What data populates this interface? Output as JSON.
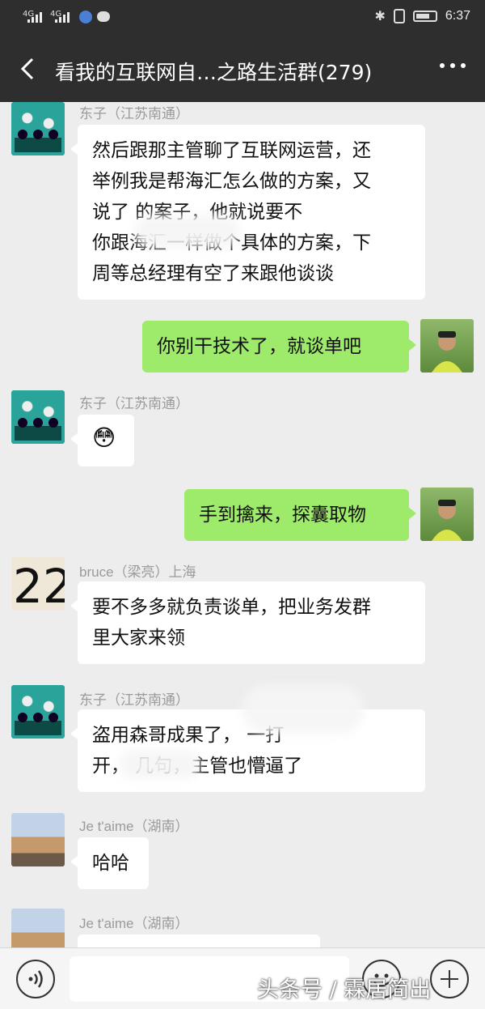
{
  "status_bar": {
    "signal1": "4G",
    "signal2": "4G",
    "notif_badge": "✉",
    "time": "6:37"
  },
  "header": {
    "title": "看我的互联网自…之路生活群(279)",
    "back_icon": "chevron-left-icon",
    "more_icon": "more-dots-icon"
  },
  "messages": [
    {
      "sender": "东子（江苏南通）",
      "side": "left",
      "lines": [
        "然后跟那主管聊了互联网运营，还",
        "举例我是帮海汇怎么做的方案，又",
        "说了            的案子，他就说要不",
        "你跟海汇一样做个具体的方案，下",
        "周等总经理有空了来跟他谈谈"
      ]
    },
    {
      "sender": "me",
      "side": "right",
      "lines": [
        "你别干技术了，就谈单吧"
      ]
    },
    {
      "sender": "东子（江苏南通）",
      "side": "left",
      "lines": [
        "😳"
      ]
    },
    {
      "sender": "me",
      "side": "right",
      "lines": [
        "手到擒来，探囊取物"
      ]
    },
    {
      "sender": "bruce（梁亮）上海",
      "side": "left",
      "avatar_text": "22",
      "lines": [
        "要不多多就负责谈单，把业务发群",
        "里大家来领"
      ]
    },
    {
      "sender": "东子（江苏南通）",
      "side": "left",
      "lines": [
        "盗用森哥成果了，           一打",
        "开，          几句，主管也懵逼了"
      ]
    },
    {
      "sender": "Je t'aime（湖南）",
      "side": "left",
      "lines": [
        "哈哈"
      ]
    },
    {
      "sender": "Je t'aime（湖南）",
      "side": "left",
      "lines": [
        ""
      ]
    }
  ],
  "input_bar": {
    "voice_icon": "voice-icon",
    "emoji_icon": "emoji-icon",
    "plus_icon": "plus-icon",
    "value": ""
  },
  "watermark": "头条号 / 霖居简出",
  "colors": {
    "header_bg": "#2e2e2e",
    "chat_bg": "#ededed",
    "my_bubble": "#9eea6a",
    "other_bubble": "#ffffff"
  }
}
